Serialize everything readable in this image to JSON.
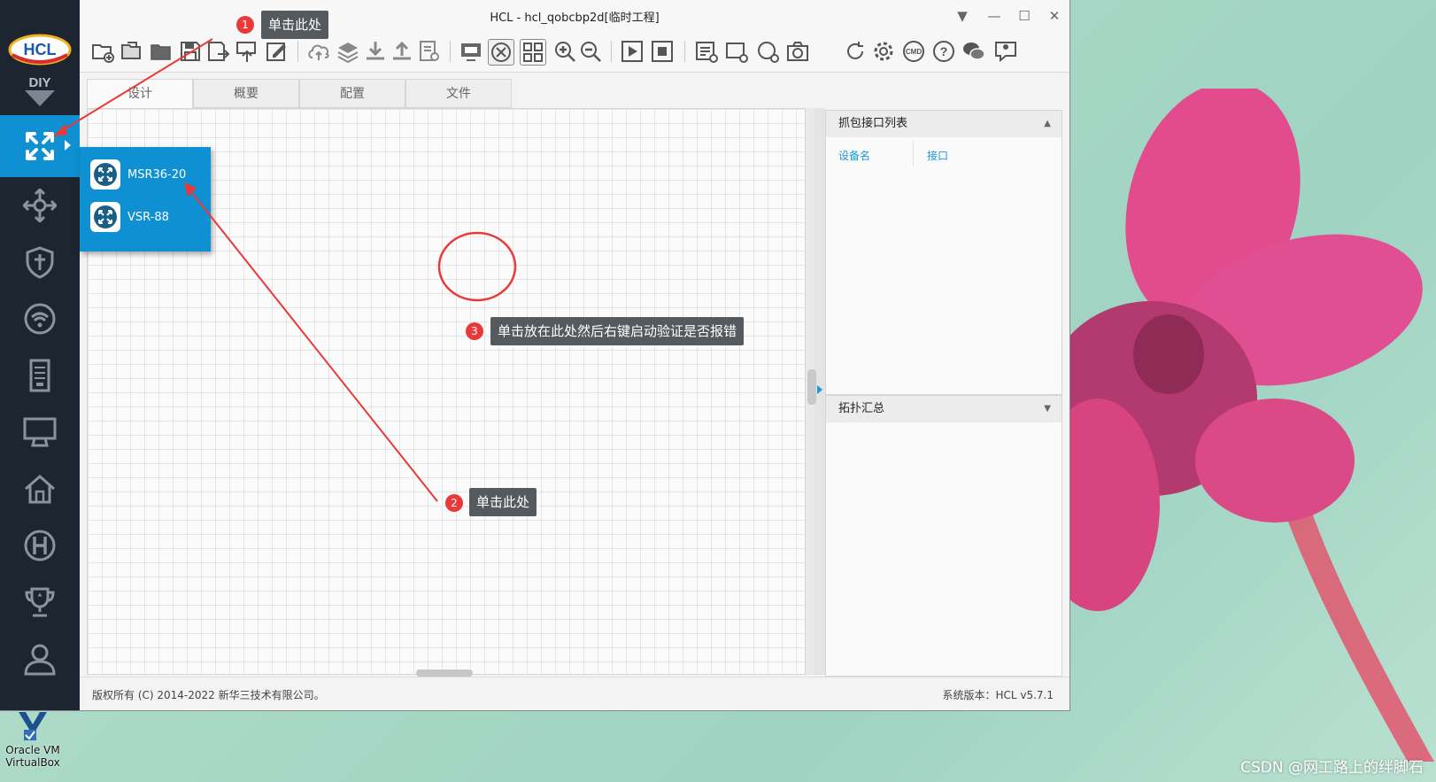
{
  "window": {
    "title": "HCL - hcl_qobcbp2d[临时工程]",
    "controls": [
      "▼",
      "—",
      "☐",
      "✕"
    ]
  },
  "sidebar": {
    "logo_text": "HCL",
    "diy_text": "DIY",
    "items": [
      {
        "icon": "router-icon",
        "active": true
      },
      {
        "icon": "switch-icon"
      },
      {
        "icon": "firewall-icon"
      },
      {
        "icon": "wireless-icon"
      },
      {
        "icon": "server-icon"
      },
      {
        "icon": "pc-terminal-icon"
      },
      {
        "icon": "home-icon"
      },
      {
        "icon": "h-logo-icon"
      },
      {
        "icon": "trophy-icon"
      },
      {
        "icon": "user-icon"
      }
    ]
  },
  "flyout": {
    "items": [
      {
        "label": "MSR36-20"
      },
      {
        "label": "VSR-88"
      }
    ]
  },
  "tabs": [
    {
      "label": "设计",
      "active": true
    },
    {
      "label": "概要"
    },
    {
      "label": "配置"
    },
    {
      "label": "文件"
    }
  ],
  "capture_panel": {
    "title": "抓包接口列表",
    "col_device": "设备名",
    "col_interface": "接口"
  },
  "topology_panel": {
    "title": "拓扑汇总"
  },
  "status": {
    "copyright": "版权所有 (C) 2014-2022 新华三技术有限公司。",
    "version": "系统版本：HCL v5.7.1"
  },
  "annotations": {
    "step1": {
      "num": "1",
      "text": "单击此处"
    },
    "step2": {
      "num": "2",
      "text": "单击此处"
    },
    "step3": {
      "num": "3",
      "text": "单击放在此处然后右键启动验证是否报错"
    }
  },
  "desktop": {
    "icon_label_line1": "Oracle VM",
    "icon_label_line2": "VirtualBox",
    "watermark": "CSDN @网工路上的绊脚石"
  },
  "colors": {
    "accent": "#0e90d2",
    "sidebar": "#1d2531",
    "annotation_red": "#e83a3a"
  }
}
